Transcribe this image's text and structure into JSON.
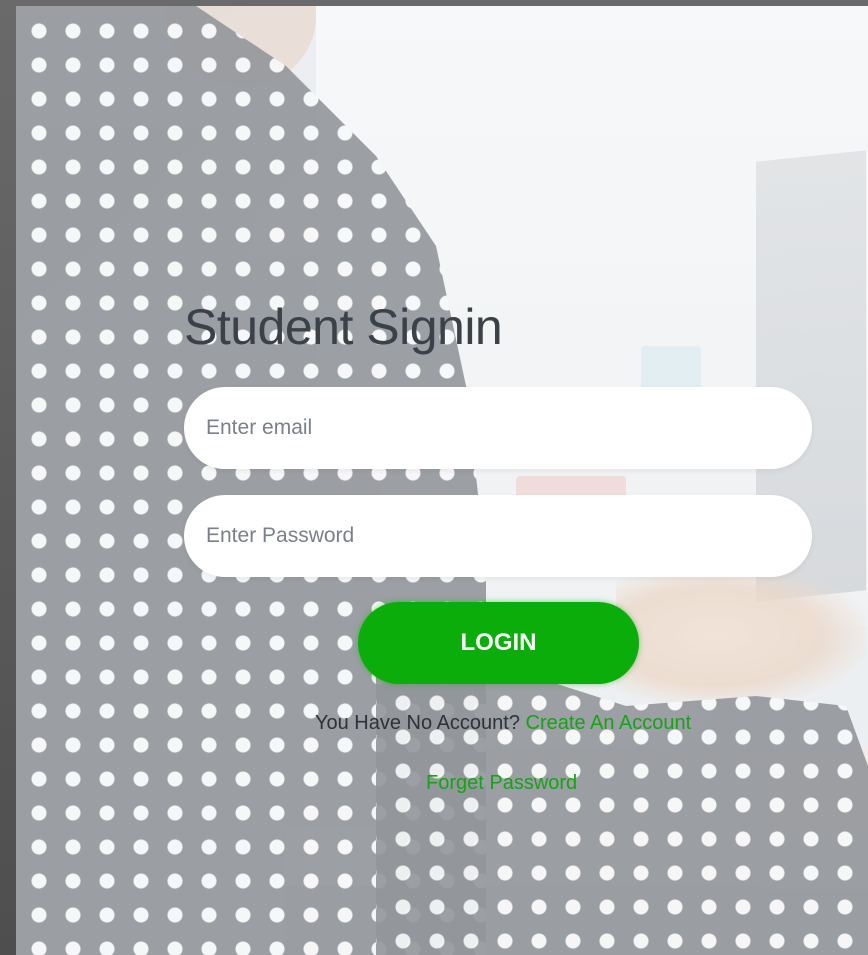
{
  "form": {
    "title": "Student Signin",
    "email_placeholder": "Enter email",
    "email_value": "",
    "password_placeholder": "Enter Password",
    "password_value": "",
    "login_label": "LOGIN",
    "no_account_text": "You Have No Account?",
    "create_account_link": "Create An Account",
    "forget_password_link": "Forget Password"
  },
  "colors": {
    "accent": "#0aad0a",
    "link": "#16a316",
    "title": "#3c4147"
  }
}
